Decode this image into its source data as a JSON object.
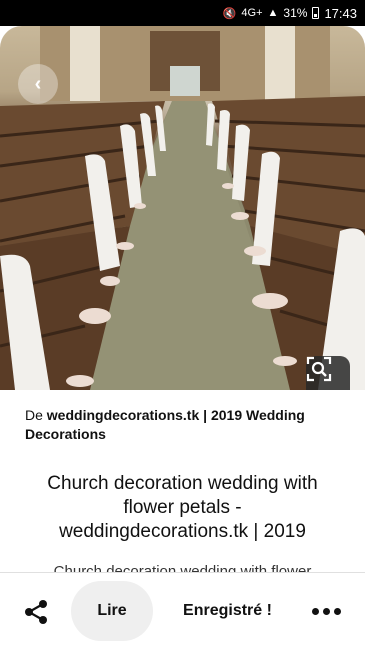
{
  "status_bar": {
    "network": "4G+",
    "battery": "31%",
    "time": "17:43"
  },
  "image": {
    "description_icon": "church-aisle-photo"
  },
  "pin": {
    "source_prefix": "De ",
    "source_domain": "weddingdecorations.tk",
    "source_rest": " | 2019 Wedding Decorations",
    "title": "Church decoration wedding with flower petals - weddingdecorations.tk | 2019",
    "description": "Church decoration wedding with flower"
  },
  "actions": {
    "read_label": "Lire",
    "saved_label": "Enregistré !"
  }
}
